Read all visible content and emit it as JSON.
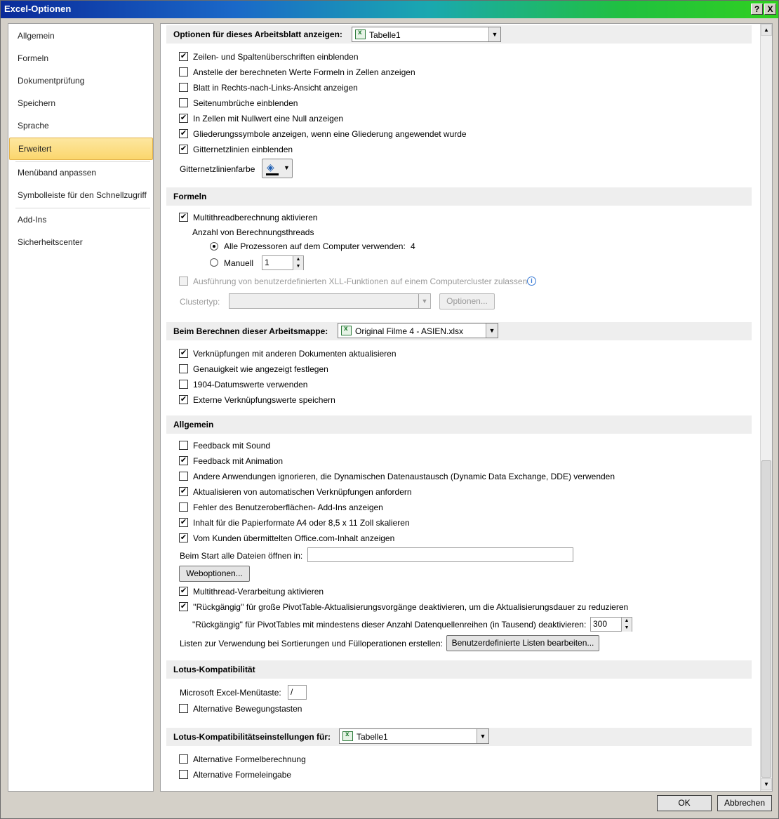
{
  "window": {
    "title": "Excel-Optionen",
    "help_btn": "?",
    "close_btn": "X"
  },
  "nav": {
    "items": [
      {
        "label": "Allgemein"
      },
      {
        "label": "Formeln"
      },
      {
        "label": "Dokumentprüfung"
      },
      {
        "label": "Speichern"
      },
      {
        "label": "Sprache"
      },
      {
        "label": "Erweitert",
        "active": true
      },
      {
        "label": "Menüband anpassen"
      },
      {
        "label": "Symbolleiste für den Schnellzugriff"
      },
      {
        "label": "Add-Ins"
      },
      {
        "label": "Sicherheitscenter"
      }
    ]
  },
  "sheet_display": {
    "header": "Optionen für dieses Arbeitsblatt anzeigen:",
    "sheet_select": "Tabelle1",
    "options": [
      {
        "label": "Zeilen- und Spaltenüberschriften einblenden",
        "checked": true
      },
      {
        "label": "Anstelle der berechneten Werte Formeln in Zellen anzeigen",
        "checked": false
      },
      {
        "label": "Blatt in Rechts-nach-Links-Ansicht anzeigen",
        "checked": false
      },
      {
        "label": "Seitenumbrüche einblenden",
        "checked": false
      },
      {
        "label": "In Zellen mit Nullwert eine Null anzeigen",
        "checked": true
      },
      {
        "label": "Gliederungssymbole anzeigen, wenn eine Gliederung angewendet wurde",
        "checked": true
      },
      {
        "label": "Gitternetzlinien einblenden",
        "checked": true
      }
    ],
    "gridline_color_label": "Gitternetzlinienfarbe"
  },
  "formulas": {
    "header": "Formeln",
    "multithread": {
      "label": "Multithreadberechnung aktivieren",
      "checked": true
    },
    "threads_label": "Anzahl von Berechnungsthreads",
    "all_processors": {
      "label": "Alle Prozessoren auf dem Computer verwenden:",
      "value": "4",
      "selected": true
    },
    "manual": {
      "label": "Manuell",
      "value": "1",
      "selected": false
    },
    "xll": {
      "label": "Ausführung von benutzerdefinierten XLL-Funktionen auf einem Computercluster zulassen",
      "checked": false
    },
    "cluster_type_label": "Clustertyp:",
    "options_button": "Optionen..."
  },
  "workbook_calc": {
    "header": "Beim Berechnen dieser Arbeitsmappe:",
    "workbook_select": "Original Filme 4 - ASIEN.xlsx",
    "options": [
      {
        "label": "Verknüpfungen mit anderen Dokumenten aktualisieren",
        "checked": true
      },
      {
        "label": "Genauigkeit wie angezeigt festlegen",
        "checked": false
      },
      {
        "label": "1904-Datumswerte verwenden",
        "checked": false
      },
      {
        "label": "Externe Verknüpfungswerte speichern",
        "checked": true
      }
    ]
  },
  "general": {
    "header": "Allgemein",
    "options": [
      {
        "label": "Feedback mit Sound",
        "checked": false
      },
      {
        "label": "Feedback mit Animation",
        "checked": true
      },
      {
        "label": "Andere Anwendungen ignorieren, die Dynamischen Datenaustausch (Dynamic Data Exchange, DDE) verwenden",
        "checked": false
      },
      {
        "label": "Aktualisieren von automatischen Verknüpfungen anfordern",
        "checked": true
      },
      {
        "label": "Fehler des Benutzeroberflächen- Add-Ins anzeigen",
        "checked": false
      },
      {
        "label": "Inhalt für die Papierformate A4 oder 8,5 x 11 Zoll skalieren",
        "checked": true
      },
      {
        "label": "Vom Kunden übermittelten Office.com-Inhalt anzeigen",
        "checked": true
      }
    ],
    "startup_label": "Beim Start alle Dateien öffnen in:",
    "startup_value": "",
    "web_options_button": "Weboptionen...",
    "options2": [
      {
        "label": "Multithread-Verarbeitung aktivieren",
        "checked": true
      },
      {
        "label": "''Rückgängig'' für große PivotTable-Aktualisierungsvorgänge deaktivieren, um die Aktualisierungsdauer zu reduzieren",
        "checked": true
      }
    ],
    "pivot_undo_label": "\"Rückgängig\" für PivotTables mit mindestens dieser Anzahl Datenquellenreihen (in Tausend) deaktivieren:",
    "pivot_undo_value": "300",
    "lists_label": "Listen zur Verwendung bei Sortierungen und Fülloperationen erstellen:",
    "lists_button": "Benutzerdefinierte Listen bearbeiten..."
  },
  "lotus": {
    "header": "Lotus-Kompatibilität",
    "menu_key_label": "Microsoft Excel-Menütaste:",
    "menu_key_value": "/",
    "alt_nav": {
      "label": "Alternative Bewegungstasten",
      "checked": false
    }
  },
  "lotus_settings": {
    "header": "Lotus-Kompatibilitätseinstellungen für:",
    "sheet_select": "Tabelle1",
    "options": [
      {
        "label": "Alternative Formelberechnung",
        "checked": false
      },
      {
        "label": "Alternative Formeleingabe",
        "checked": false
      }
    ]
  },
  "footer": {
    "ok": "OK",
    "cancel": "Abbrechen"
  }
}
